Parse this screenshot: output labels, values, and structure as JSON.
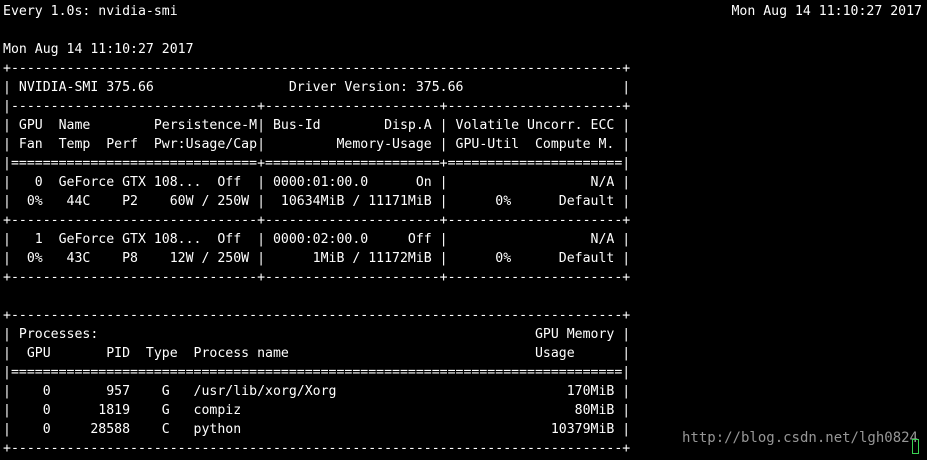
{
  "watch_header": {
    "command": "Every 1.0s: nvidia-smi",
    "clock": "Mon Aug 14 11:10:27 2017"
  },
  "timestamp": "Mon Aug 14 11:10:27 2017",
  "smi_output": {
    "lines": [
      "+-----------------------------------------------------------------------------+",
      "| NVIDIA-SMI 375.66                 Driver Version: 375.66                    |",
      "|-------------------------------+----------------------+----------------------+",
      "| GPU  Name        Persistence-M| Bus-Id        Disp.A | Volatile Uncorr. ECC |",
      "| Fan  Temp  Perf  Pwr:Usage/Cap|         Memory-Usage | GPU-Util  Compute M. |",
      "|===============================+======================+======================|",
      "|   0  GeForce GTX 108...  Off  | 0000:01:00.0      On |                  N/A |",
      "|  0%   44C    P2    60W / 250W |  10634MiB / 11171MiB |      0%      Default |",
      "+-------------------------------+----------------------+----------------------+",
      "|   1  GeForce GTX 108...  Off  | 0000:02:00.0     Off |                  N/A |",
      "|  0%   43C    P8    12W / 250W |      1MiB / 11172MiB |      0%      Default |",
      "+-------------------------------+----------------------+----------------------+",
      "",
      "+-----------------------------------------------------------------------------+",
      "| Processes:                                                       GPU Memory |",
      "|  GPU       PID  Type  Process name                               Usage      |",
      "|=============================================================================|",
      "|    0       957    G   /usr/lib/xorg/Xorg                             170MiB |",
      "|    0      1819    G   compiz                                          80MiB |",
      "|    0     28588    C   python                                       10379MiB |",
      "+-----------------------------------------------------------------------------+"
    ]
  },
  "watermark": "http://blog.csdn.net/lgh0824",
  "colors": {
    "background": "#000000",
    "text": "#ffffff",
    "cursor": "#39d353"
  }
}
